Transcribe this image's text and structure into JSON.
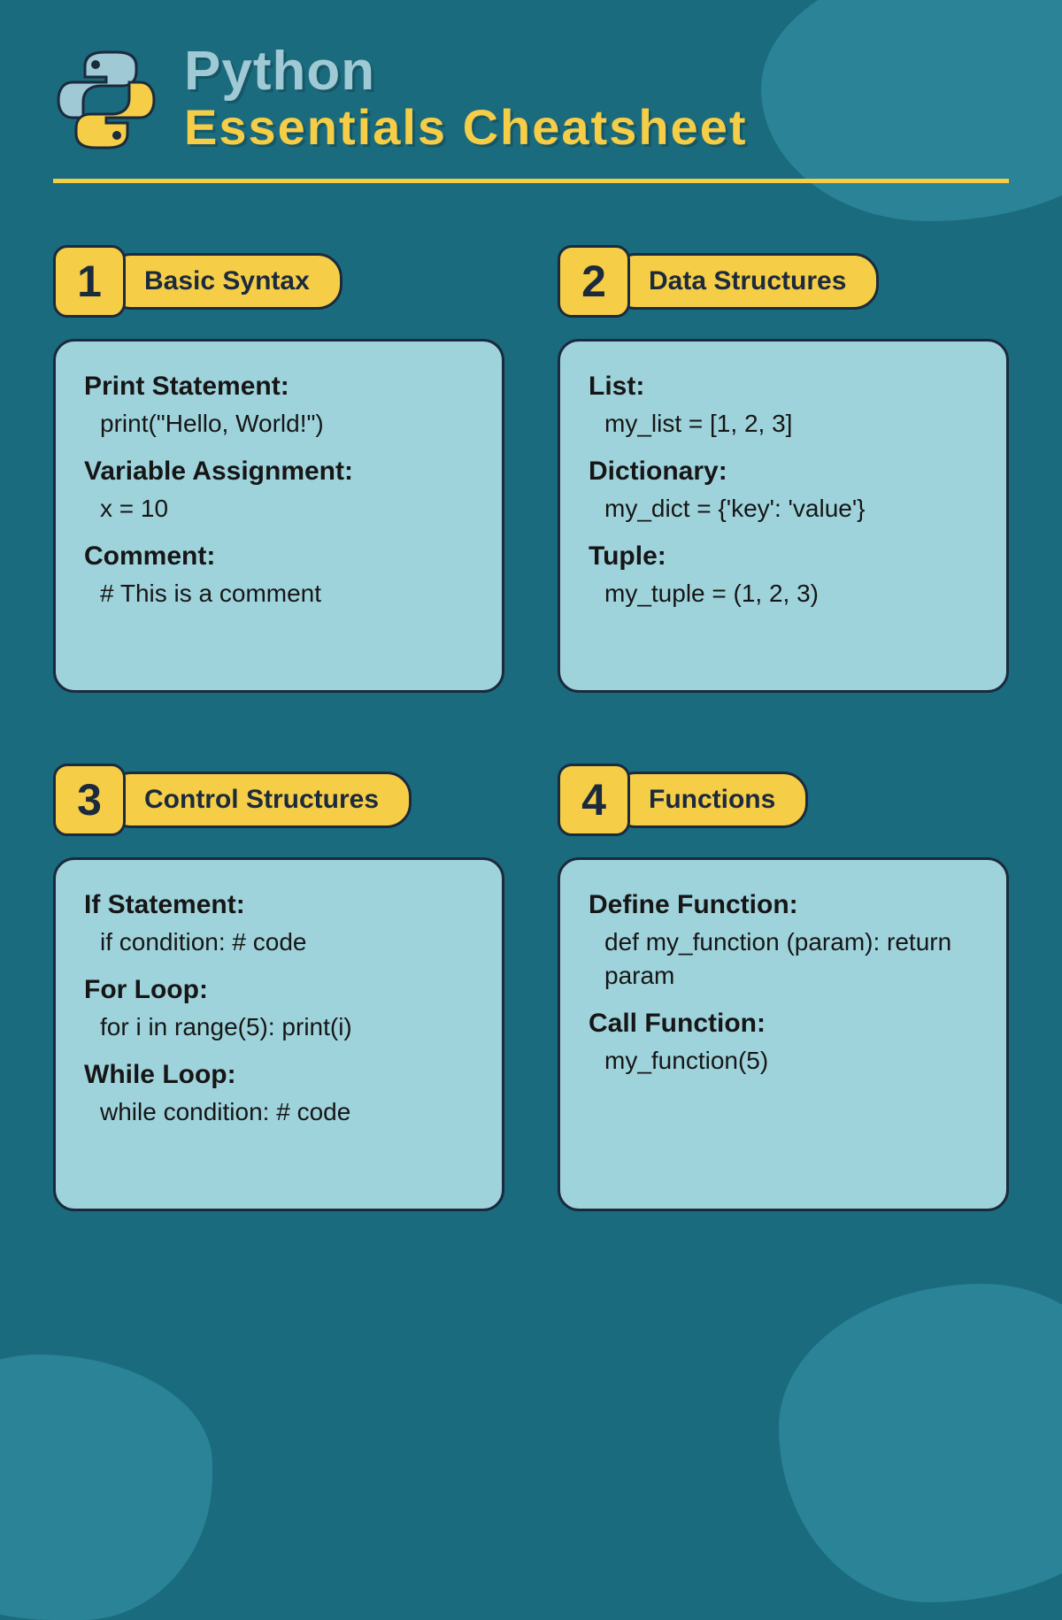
{
  "header": {
    "title_line1": "Python",
    "title_line2": "Essentials Cheatsheet"
  },
  "sections": [
    {
      "num": "1",
      "title": "Basic Syntax",
      "items": [
        {
          "label": "Print Statement:",
          "code": "print(\"Hello, World!\")"
        },
        {
          "label": "Variable Assignment:",
          "code": "x = 10"
        },
        {
          "label": "Comment:",
          "code": "# This is a comment"
        }
      ]
    },
    {
      "num": "2",
      "title": "Data Structures",
      "items": [
        {
          "label": "List:",
          "code": "my_list = [1, 2, 3]"
        },
        {
          "label": "Dictionary:",
          "code": "my_dict = {'key': 'value'}"
        },
        {
          "label": "Tuple:",
          "code": "my_tuple = (1, 2, 3)"
        }
      ]
    },
    {
      "num": "3",
      "title": "Control Structures",
      "items": [
        {
          "label": "If Statement:",
          "code": "if condition:  # code"
        },
        {
          "label": "For Loop:",
          "code": "for i in range(5): print(i)"
        },
        {
          "label": "While Loop:",
          "code": "while condition: # code"
        }
      ]
    },
    {
      "num": "4",
      "title": "Functions",
      "items": [
        {
          "label": "Define Function:",
          "code": "def my_function (param): return param"
        },
        {
          "label": "Call Function:",
          "code": "my_function(5)"
        }
      ]
    }
  ]
}
